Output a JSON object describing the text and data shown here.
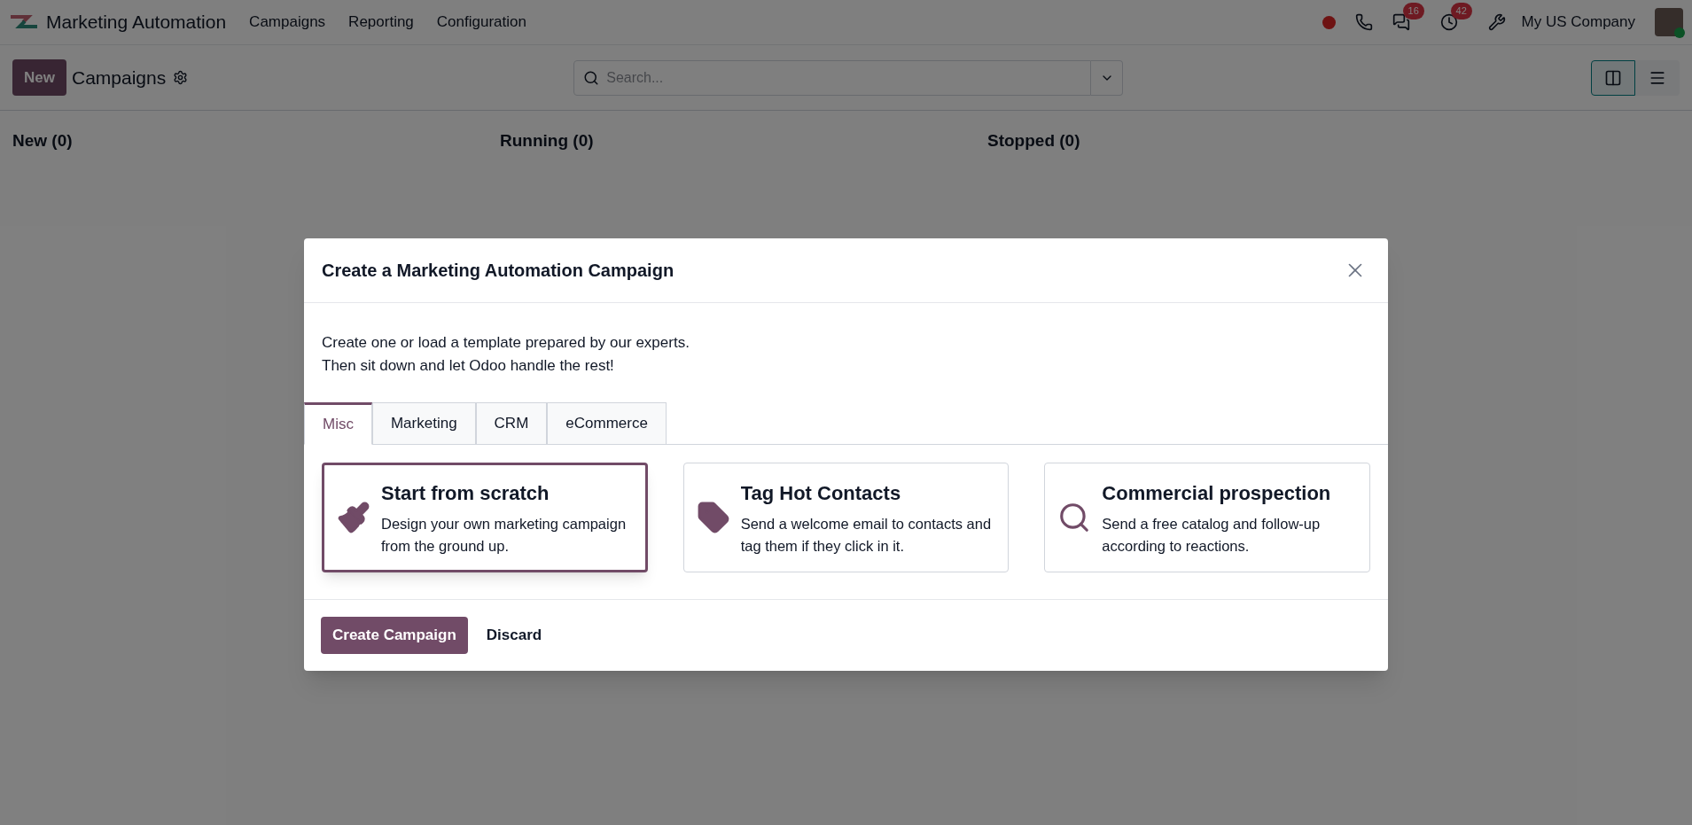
{
  "navbar": {
    "app_name": "Marketing Automation",
    "menu": [
      "Campaigns",
      "Reporting",
      "Configuration"
    ],
    "messages_count": "16",
    "activities_count": "42",
    "company": "My US Company"
  },
  "control_panel": {
    "new_button": "New",
    "title": "Campaigns",
    "search": {
      "placeholder": "Search..."
    },
    "views": [
      {
        "kind": "kanban",
        "selected": true
      },
      {
        "kind": "list",
        "selected": false
      }
    ]
  },
  "kanban_columns": [
    "New (0)",
    "Running (0)",
    "Stopped (0)"
  ],
  "dialog": {
    "title": "Create a Marketing Automation Campaign",
    "intro": [
      "Create one or load a template prepared by our experts.",
      "Then sit down and let Odoo handle the rest!"
    ],
    "tabs": [
      {
        "label": "Misc",
        "selected": true
      },
      {
        "label": "Marketing",
        "selected": false
      },
      {
        "label": "CRM",
        "selected": false
      },
      {
        "label": "eCommerce",
        "selected": false
      }
    ],
    "templates": [
      {
        "kind": "brush",
        "title": "Start from scratch",
        "description": "Design your own marketing campaign from the ground up.",
        "selected": true
      },
      {
        "kind": "tag",
        "title": "Tag Hot Contacts",
        "description": "Send a welcome email to contacts and tag them if they click in it.",
        "selected": false
      },
      {
        "kind": "search",
        "title": "Commercial prospection",
        "description": "Send a free catalog and follow-up according to reactions.",
        "selected": false
      }
    ],
    "buttons": [
      "Create Campaign",
      "Discard"
    ]
  }
}
